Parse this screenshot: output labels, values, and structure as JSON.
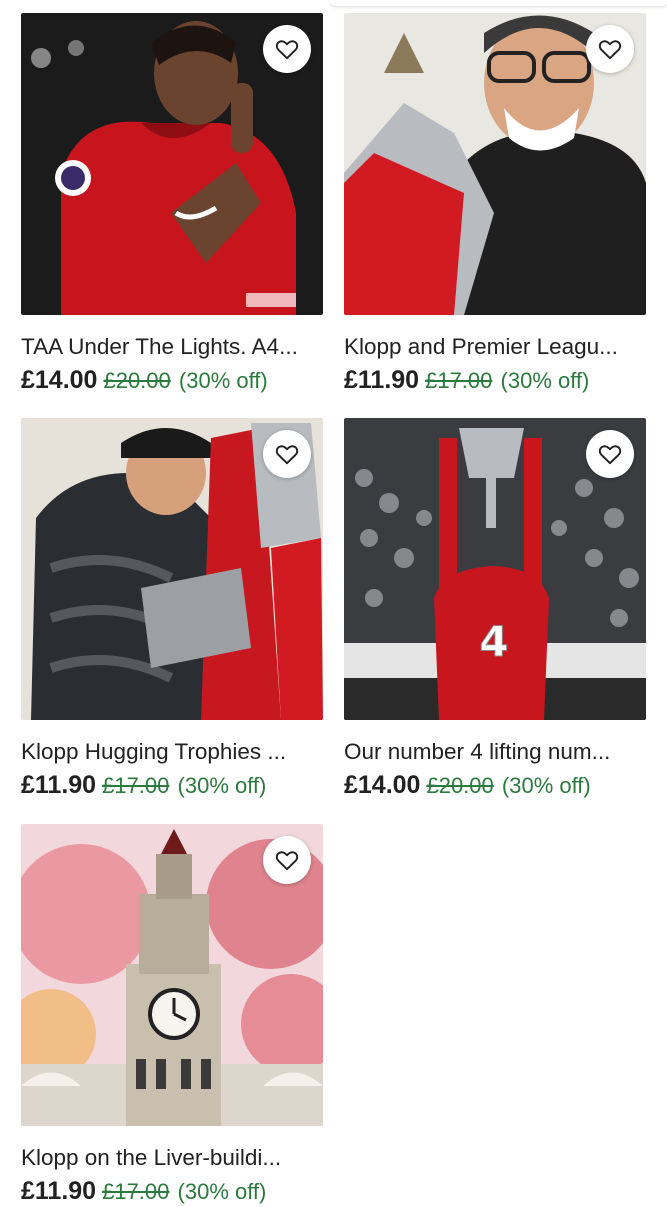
{
  "listings": [
    {
      "title": "TAA Under The Lights. A4...",
      "price": "£14.00",
      "original_price": "£20.00",
      "discount": "(30% off)",
      "favorite_icon": "heart-outline-icon"
    },
    {
      "title": "Klopp and Premier Leagu...",
      "price": "£11.90",
      "original_price": "£17.00",
      "discount": "(30% off)",
      "favorite_icon": "heart-outline-icon"
    },
    {
      "title": "Klopp Hugging Trophies ...",
      "price": "£11.90",
      "original_price": "£17.00",
      "discount": "(30% off)",
      "favorite_icon": "heart-outline-icon"
    },
    {
      "title": "Our number 4 lifting num...",
      "price": "£14.00",
      "original_price": "£20.00",
      "discount": "(30% off)",
      "favorite_icon": "heart-outline-icon"
    },
    {
      "title": "Klopp on the Liver-buildi...",
      "price": "£11.90",
      "original_price": "£17.00",
      "discount": "(30% off)",
      "favorite_icon": "heart-outline-icon"
    }
  ],
  "colors": {
    "discount_green": "#2b7a3e",
    "text": "#222222"
  }
}
